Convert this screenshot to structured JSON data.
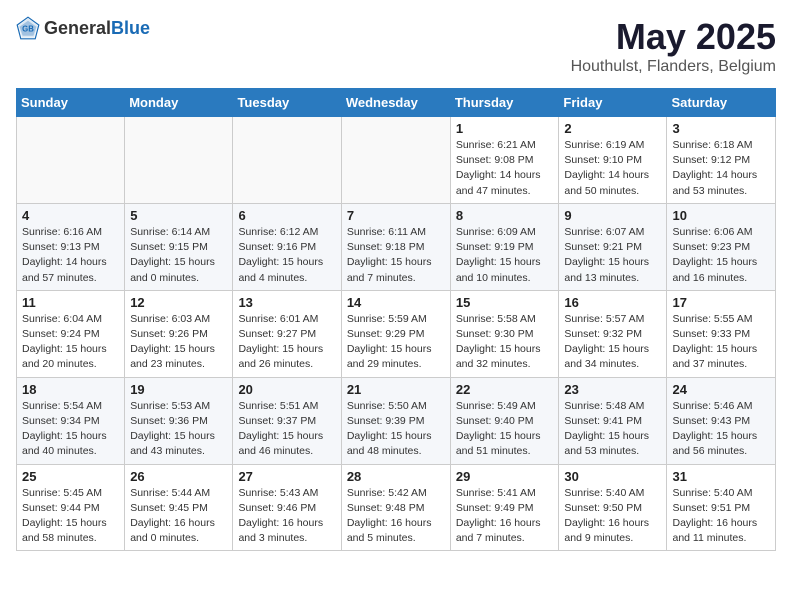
{
  "header": {
    "logo_general": "General",
    "logo_blue": "Blue",
    "main_title": "May 2025",
    "sub_title": "Houthulst, Flanders, Belgium"
  },
  "days_of_week": [
    "Sunday",
    "Monday",
    "Tuesday",
    "Wednesday",
    "Thursday",
    "Friday",
    "Saturday"
  ],
  "weeks": [
    {
      "cells": [
        {
          "day": "",
          "info": ""
        },
        {
          "day": "",
          "info": ""
        },
        {
          "day": "",
          "info": ""
        },
        {
          "day": "",
          "info": ""
        },
        {
          "day": "1",
          "info": "Sunrise: 6:21 AM\nSunset: 9:08 PM\nDaylight: 14 hours\nand 47 minutes."
        },
        {
          "day": "2",
          "info": "Sunrise: 6:19 AM\nSunset: 9:10 PM\nDaylight: 14 hours\nand 50 minutes."
        },
        {
          "day": "3",
          "info": "Sunrise: 6:18 AM\nSunset: 9:12 PM\nDaylight: 14 hours\nand 53 minutes."
        }
      ]
    },
    {
      "cells": [
        {
          "day": "4",
          "info": "Sunrise: 6:16 AM\nSunset: 9:13 PM\nDaylight: 14 hours\nand 57 minutes."
        },
        {
          "day": "5",
          "info": "Sunrise: 6:14 AM\nSunset: 9:15 PM\nDaylight: 15 hours\nand 0 minutes."
        },
        {
          "day": "6",
          "info": "Sunrise: 6:12 AM\nSunset: 9:16 PM\nDaylight: 15 hours\nand 4 minutes."
        },
        {
          "day": "7",
          "info": "Sunrise: 6:11 AM\nSunset: 9:18 PM\nDaylight: 15 hours\nand 7 minutes."
        },
        {
          "day": "8",
          "info": "Sunrise: 6:09 AM\nSunset: 9:19 PM\nDaylight: 15 hours\nand 10 minutes."
        },
        {
          "day": "9",
          "info": "Sunrise: 6:07 AM\nSunset: 9:21 PM\nDaylight: 15 hours\nand 13 minutes."
        },
        {
          "day": "10",
          "info": "Sunrise: 6:06 AM\nSunset: 9:23 PM\nDaylight: 15 hours\nand 16 minutes."
        }
      ]
    },
    {
      "cells": [
        {
          "day": "11",
          "info": "Sunrise: 6:04 AM\nSunset: 9:24 PM\nDaylight: 15 hours\nand 20 minutes."
        },
        {
          "day": "12",
          "info": "Sunrise: 6:03 AM\nSunset: 9:26 PM\nDaylight: 15 hours\nand 23 minutes."
        },
        {
          "day": "13",
          "info": "Sunrise: 6:01 AM\nSunset: 9:27 PM\nDaylight: 15 hours\nand 26 minutes."
        },
        {
          "day": "14",
          "info": "Sunrise: 5:59 AM\nSunset: 9:29 PM\nDaylight: 15 hours\nand 29 minutes."
        },
        {
          "day": "15",
          "info": "Sunrise: 5:58 AM\nSunset: 9:30 PM\nDaylight: 15 hours\nand 32 minutes."
        },
        {
          "day": "16",
          "info": "Sunrise: 5:57 AM\nSunset: 9:32 PM\nDaylight: 15 hours\nand 34 minutes."
        },
        {
          "day": "17",
          "info": "Sunrise: 5:55 AM\nSunset: 9:33 PM\nDaylight: 15 hours\nand 37 minutes."
        }
      ]
    },
    {
      "cells": [
        {
          "day": "18",
          "info": "Sunrise: 5:54 AM\nSunset: 9:34 PM\nDaylight: 15 hours\nand 40 minutes."
        },
        {
          "day": "19",
          "info": "Sunrise: 5:53 AM\nSunset: 9:36 PM\nDaylight: 15 hours\nand 43 minutes."
        },
        {
          "day": "20",
          "info": "Sunrise: 5:51 AM\nSunset: 9:37 PM\nDaylight: 15 hours\nand 46 minutes."
        },
        {
          "day": "21",
          "info": "Sunrise: 5:50 AM\nSunset: 9:39 PM\nDaylight: 15 hours\nand 48 minutes."
        },
        {
          "day": "22",
          "info": "Sunrise: 5:49 AM\nSunset: 9:40 PM\nDaylight: 15 hours\nand 51 minutes."
        },
        {
          "day": "23",
          "info": "Sunrise: 5:48 AM\nSunset: 9:41 PM\nDaylight: 15 hours\nand 53 minutes."
        },
        {
          "day": "24",
          "info": "Sunrise: 5:46 AM\nSunset: 9:43 PM\nDaylight: 15 hours\nand 56 minutes."
        }
      ]
    },
    {
      "cells": [
        {
          "day": "25",
          "info": "Sunrise: 5:45 AM\nSunset: 9:44 PM\nDaylight: 15 hours\nand 58 minutes."
        },
        {
          "day": "26",
          "info": "Sunrise: 5:44 AM\nSunset: 9:45 PM\nDaylight: 16 hours\nand 0 minutes."
        },
        {
          "day": "27",
          "info": "Sunrise: 5:43 AM\nSunset: 9:46 PM\nDaylight: 16 hours\nand 3 minutes."
        },
        {
          "day": "28",
          "info": "Sunrise: 5:42 AM\nSunset: 9:48 PM\nDaylight: 16 hours\nand 5 minutes."
        },
        {
          "day": "29",
          "info": "Sunrise: 5:41 AM\nSunset: 9:49 PM\nDaylight: 16 hours\nand 7 minutes."
        },
        {
          "day": "30",
          "info": "Sunrise: 5:40 AM\nSunset: 9:50 PM\nDaylight: 16 hours\nand 9 minutes."
        },
        {
          "day": "31",
          "info": "Sunrise: 5:40 AM\nSunset: 9:51 PM\nDaylight: 16 hours\nand 11 minutes."
        }
      ]
    }
  ]
}
